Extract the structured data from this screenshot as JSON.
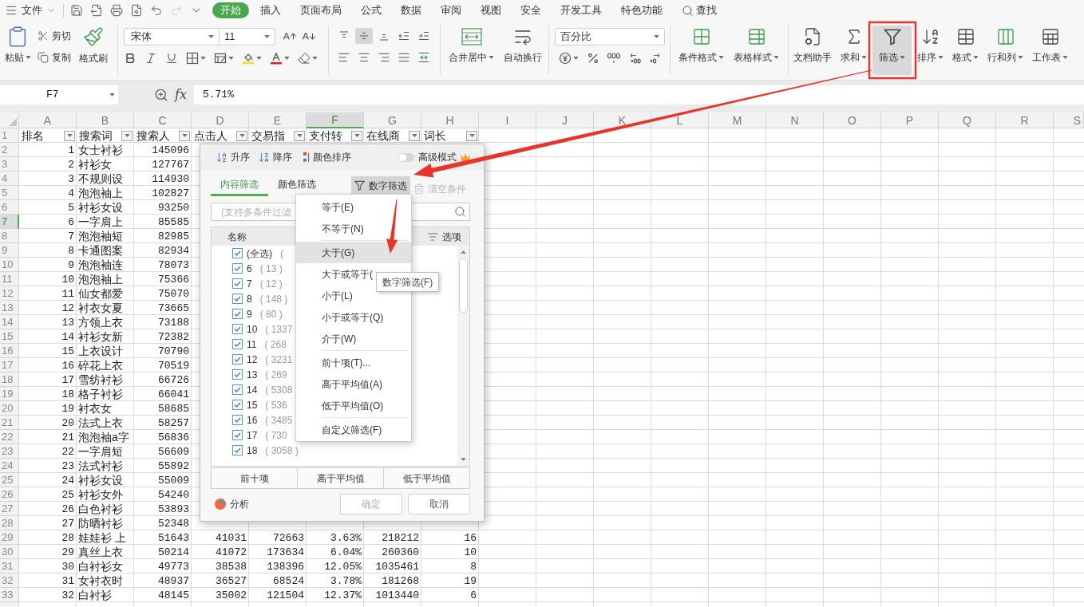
{
  "menu_bar": {
    "file": "文件",
    "redo": {
      "disabled": true
    },
    "tabs": [
      {
        "label": "开始",
        "selected": true
      },
      {
        "label": "插入",
        "selected": false
      },
      {
        "label": "页面布局",
        "selected": false
      },
      {
        "label": "公式",
        "selected": false
      },
      {
        "label": "数据",
        "selected": false
      },
      {
        "label": "审阅",
        "selected": false
      },
      {
        "label": "视图",
        "selected": false
      },
      {
        "label": "安全",
        "selected": false
      },
      {
        "label": "开发工具",
        "selected": false
      },
      {
        "label": "特色功能",
        "selected": false
      }
    ],
    "search": "查找"
  },
  "ribbon": {
    "clipboard": {
      "paste": "粘贴",
      "cut": "剪切",
      "copy": "复制",
      "format_painter": "格式刷"
    },
    "font": {
      "name": "宋体",
      "size": "11"
    },
    "vertical_align": [
      {
        "pressed": false
      },
      {
        "pressed": true
      },
      {
        "pressed": false
      }
    ],
    "merge_buttons": [
      {
        "label": "合并居中",
        "dropdown": true
      },
      {
        "label": "自动换行",
        "dropdown": false
      }
    ],
    "number_format": "百分比",
    "style_buttons": [
      {
        "label": "条件格式",
        "dropdown": true
      },
      {
        "label": "表格样式",
        "dropdown": true
      }
    ],
    "tool_buttons": [
      {
        "label": "文档助手",
        "dropdown": false,
        "pressed": false
      },
      {
        "label": "求和",
        "dropdown": true,
        "pressed": false
      },
      {
        "label": "筛选",
        "dropdown": true,
        "pressed": true
      },
      {
        "label": "排序",
        "dropdown": true,
        "pressed": false
      },
      {
        "label": "格式",
        "dropdown": true,
        "pressed": false
      },
      {
        "label": "行和列",
        "dropdown": true,
        "pressed": false
      },
      {
        "label": "工作表",
        "dropdown": true,
        "pressed": false
      }
    ]
  },
  "formula_bar": {
    "cell": "F7",
    "function_label": "fx",
    "value": "5.71%"
  },
  "sheet": {
    "columns": [
      {
        "label": "A",
        "selected": false
      },
      {
        "label": "B",
        "selected": false
      },
      {
        "label": "C",
        "selected": false
      },
      {
        "label": "D",
        "selected": false
      },
      {
        "label": "E",
        "selected": false
      },
      {
        "label": "F",
        "selected": true
      },
      {
        "label": "G",
        "selected": false
      },
      {
        "label": "H",
        "selected": false
      },
      {
        "label": "I",
        "selected": false
      },
      {
        "label": "J",
        "selected": false
      },
      {
        "label": "K",
        "selected": false
      },
      {
        "label": "L",
        "selected": false
      },
      {
        "label": "M",
        "selected": false
      },
      {
        "label": "N",
        "selected": false
      },
      {
        "label": "O",
        "selected": false
      },
      {
        "label": "P",
        "selected": false
      },
      {
        "label": "Q",
        "selected": false
      },
      {
        "label": "R",
        "selected": false
      },
      {
        "label": "S",
        "selected": false
      }
    ],
    "header_row": {
      "number": "1",
      "selected": false,
      "cells": [
        "排名",
        "搜索词",
        "搜索人",
        "点击人",
        "交易指",
        "支付转",
        "在线商",
        "词长"
      ]
    },
    "rows": [
      {
        "number": "2",
        "selected": false,
        "cells": [
          "1",
          "女士衬衫",
          "145096"
        ]
      },
      {
        "number": "3",
        "selected": false,
        "cells": [
          "2",
          "衬衫女",
          "127767"
        ]
      },
      {
        "number": "4",
        "selected": false,
        "cells": [
          "3",
          "不规则设",
          "114930"
        ]
      },
      {
        "number": "5",
        "selected": false,
        "cells": [
          "4",
          "泡泡袖上",
          "102827"
        ]
      },
      {
        "number": "6",
        "selected": false,
        "cells": [
          "5",
          "衬衫女设",
          "93250"
        ]
      },
      {
        "number": "7",
        "selected": true,
        "cells": [
          "6",
          "一字肩上",
          "85585"
        ]
      },
      {
        "number": "8",
        "selected": false,
        "cells": [
          "7",
          "泡泡袖短",
          "82985"
        ]
      },
      {
        "number": "9",
        "selected": false,
        "cells": [
          "8",
          "卡通图案",
          "82934"
        ]
      },
      {
        "number": "10",
        "selected": false,
        "cells": [
          "9",
          "泡泡袖连",
          "78073"
        ]
      },
      {
        "number": "11",
        "selected": false,
        "cells": [
          "10",
          "泡泡袖上",
          "75366"
        ]
      },
      {
        "number": "12",
        "selected": false,
        "cells": [
          "11",
          "仙女都爱",
          "75070"
        ]
      },
      {
        "number": "13",
        "selected": false,
        "cells": [
          "12",
          "衬衣女夏",
          "73665"
        ]
      },
      {
        "number": "14",
        "selected": false,
        "cells": [
          "13",
          "方领上衣",
          "73188"
        ]
      },
      {
        "number": "15",
        "selected": false,
        "cells": [
          "14",
          "衬衫女新",
          "72382"
        ]
      },
      {
        "number": "16",
        "selected": false,
        "cells": [
          "15",
          "上衣设计",
          "70790"
        ]
      },
      {
        "number": "17",
        "selected": false,
        "cells": [
          "16",
          "碎花上衣",
          "70519"
        ]
      },
      {
        "number": "18",
        "selected": false,
        "cells": [
          "17",
          "雪纺衬衫",
          "66726"
        ]
      },
      {
        "number": "19",
        "selected": false,
        "cells": [
          "18",
          "格子衬衫",
          "66041"
        ]
      },
      {
        "number": "20",
        "selected": false,
        "cells": [
          "19",
          "衬衣女",
          "58685"
        ]
      },
      {
        "number": "21",
        "selected": false,
        "cells": [
          "20",
          "法式上衣",
          "58257"
        ]
      },
      {
        "number": "22",
        "selected": false,
        "cells": [
          "21",
          "泡泡袖a字",
          "56836"
        ]
      },
      {
        "number": "23",
        "selected": false,
        "cells": [
          "22",
          "一字肩短",
          "56609"
        ]
      },
      {
        "number": "24",
        "selected": false,
        "cells": [
          "23",
          "法式衬衫",
          "55892"
        ]
      },
      {
        "number": "25",
        "selected": false,
        "cells": [
          "24",
          "衬衫女设",
          "55009"
        ]
      },
      {
        "number": "26",
        "selected": false,
        "cells": [
          "25",
          "衬衫女外",
          "54240"
        ]
      },
      {
        "number": "27",
        "selected": false,
        "cells": [
          "26",
          "白色衬衫",
          "53893"
        ]
      },
      {
        "number": "28",
        "selected": false,
        "cells": [
          "27",
          "防晒衬衫",
          "52348"
        ]
      },
      {
        "number": "29",
        "selected": false,
        "cells": [
          "28",
          "娃娃衫 上",
          "51643",
          "41031",
          "72663",
          "3.63%",
          "218212",
          "16"
        ]
      },
      {
        "number": "30",
        "selected": false,
        "cells": [
          "29",
          "真丝上衣",
          "50214",
          "41072",
          "173634",
          "6.04%",
          "260360",
          "10"
        ]
      },
      {
        "number": "31",
        "selected": false,
        "cells": [
          "30",
          "白衬衫女",
          "49773",
          "38538",
          "138396",
          "12.05%",
          "1035461",
          "8"
        ]
      },
      {
        "number": "32",
        "selected": false,
        "cells": [
          "31",
          "女衬衣时",
          "48937",
          "36527",
          "68524",
          "3.78%",
          "181268",
          "19"
        ]
      },
      {
        "number": "33",
        "selected": false,
        "cells": [
          "32",
          "白衬衫",
          "48145",
          "35002",
          "121504",
          "12.37%",
          "1013440",
          "6"
        ]
      }
    ]
  },
  "filter_panel": {
    "sort_buttons": [
      "升序",
      "降序",
      "颜色排序"
    ],
    "advanced_mode": {
      "label": "高级模式",
      "on": false
    },
    "tabs": [
      {
        "label": "内容筛选",
        "selected": true
      },
      {
        "label": "颜色筛选",
        "selected": false
      }
    ],
    "number_filter": {
      "label": "数字筛选",
      "pressed": true
    },
    "clear": {
      "label": "清空条件",
      "disabled": true
    },
    "search": {
      "placeholder": "(支持多条件过滤"
    },
    "list_header": {
      "name": "名称",
      "options": "选项"
    },
    "items": [
      {
        "label": "(全选)",
        "count": "(",
        "checked": true
      },
      {
        "label": "6",
        "count": "( 13 )",
        "checked": true
      },
      {
        "label": "7",
        "count": "( 12 )",
        "checked": true
      },
      {
        "label": "8",
        "count": "( 148 )",
        "checked": true
      },
      {
        "label": "9",
        "count": "( 80 )",
        "checked": true
      },
      {
        "label": "10",
        "count": "( 1337",
        "checked": true
      },
      {
        "label": "11",
        "count": "( 268",
        "checked": true
      },
      {
        "label": "12",
        "count": "( 3231",
        "checked": true
      },
      {
        "label": "13",
        "count": "( 269",
        "checked": true
      },
      {
        "label": "14",
        "count": "( 5308",
        "checked": true
      },
      {
        "label": "15",
        "count": "( 536",
        "checked": true
      },
      {
        "label": "16",
        "count": "( 3485",
        "checked": true
      },
      {
        "label": "17",
        "count": "( 730",
        "checked": true
      },
      {
        "label": "18",
        "count": "( 3058 )",
        "checked": true
      }
    ],
    "quick_buttons": [
      "前十项",
      "高于平均值",
      "低于平均值"
    ],
    "analysis": "分析",
    "ok": {
      "label": "确定",
      "disabled": true
    },
    "cancel": "取消"
  },
  "number_filter_menu": [
    {
      "kind": "item",
      "label": "等于(E)",
      "highlighted": false
    },
    {
      "kind": "item",
      "label": "不等于(N)",
      "highlighted": false
    },
    {
      "kind": "separator"
    },
    {
      "kind": "item",
      "label": "大于(G)",
      "highlighted": true
    },
    {
      "kind": "item",
      "label": "大于或等于(",
      "highlighted": false
    },
    {
      "kind": "item",
      "label": "小于(L)",
      "highlighted": false
    },
    {
      "kind": "item",
      "label": "小于或等于(Q)",
      "highlighted": false
    },
    {
      "kind": "item",
      "label": "介于(W)",
      "highlighted": false
    },
    {
      "kind": "separator"
    },
    {
      "kind": "item",
      "label": "前十项(T)...",
      "highlighted": false
    },
    {
      "kind": "item",
      "label": "高于平均值(A)",
      "highlighted": false
    },
    {
      "kind": "item",
      "label": "低于平均值(O)",
      "highlighted": false
    },
    {
      "kind": "separator"
    },
    {
      "kind": "item",
      "label": "自定义筛选(F)",
      "highlighted": false
    }
  ],
  "tooltip": "数字筛选(F)"
}
